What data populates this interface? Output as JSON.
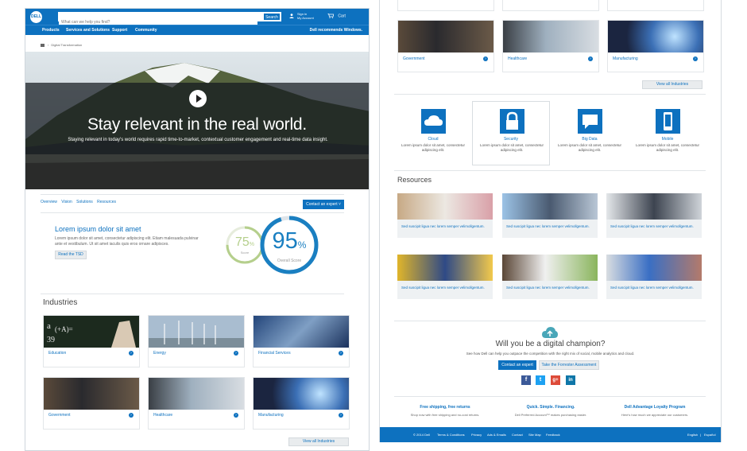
{
  "header": {
    "search_placeholder": "What can we help you find?",
    "search_button": "Search",
    "account_line1": "Sign in",
    "account_line2": "My Account",
    "cart_label": "Cart",
    "nav": [
      "Products",
      "Services and Solutions",
      "Support",
      "Community"
    ],
    "nav_right": "Dell recommends Windows."
  },
  "breadcrumb": "Digital Transformation",
  "hero": {
    "title": "Stay relevant in the real world.",
    "subtitle": "Staying relevant in today's world requires rapid time-to-market, contextual customer engagement and real-time data insight."
  },
  "tabs": [
    "Overview",
    "Vision",
    "Solutions",
    "Resources"
  ],
  "contact_button": "Contact an expert",
  "intro": {
    "title": "Lorem ipsum dolor sit amet",
    "body": "Lorem ipsum dolor sit amet, consectetur adipiscing elit. Etiam malesuada pulvinar ante et vestibulum. Ut sit amet iaculis quis eros ornare adipisces.",
    "button": "Read the TSD"
  },
  "scores": [
    {
      "value": "75",
      "unit": "%",
      "label": "Score",
      "fraction": 0.75,
      "color": "#b5cf8c"
    },
    {
      "value": "95",
      "unit": "%",
      "label": "Overall Score",
      "fraction": 0.95,
      "color": "#1a7fc1"
    }
  ],
  "industries": {
    "title": "Industries",
    "items": [
      "Education",
      "Energy",
      "Financial Services",
      "Government",
      "Healthcare",
      "Manufacturing"
    ],
    "view_all": "View all Industries"
  },
  "features": [
    {
      "title": "Cloud",
      "desc": "Lorem ipsum dolor sit amet, consectetur adipiscing elit."
    },
    {
      "title": "Security",
      "desc": "Lorem ipsum dolor sit amet, consectetur adipiscing elit."
    },
    {
      "title": "Big Data",
      "desc": "Lorem ipsum dolor sit amet, consectetur adipiscing elit."
    },
    {
      "title": "Mobile",
      "desc": "Lorem ipsum dolor sit amet, consectetur adipiscing elit."
    }
  ],
  "resources": {
    "title": "Resources",
    "caption": "Sed suscipit ligua nec lorem semper velimollgentum."
  },
  "champion": {
    "title": "Will you be a digital champion?",
    "subtitle": "See how Dell can help you outpace the competition with the right mix of social, mobile analytics and cloud.",
    "button_primary": "Contact an expert",
    "button_secondary": "Take the Forrester Assessment"
  },
  "social": [
    "f",
    "t",
    "g+",
    "in"
  ],
  "footer_promos": [
    {
      "title": "Free shipping, free returns",
      "desc": "Shop now with free shipping and no-cost returns."
    },
    {
      "title": "Quick. Simple. Financing.",
      "desc": "Dell Preferred Account™ makes purchasing easier."
    },
    {
      "title": "Dell Advantage Loyalty Program",
      "desc": "Here's how much we appreciate our customers."
    }
  ],
  "footer": {
    "copyright": "© 2014 Dell",
    "links": [
      "Terms & Conditions",
      "Privacy",
      "Ads & Emails",
      "Contact",
      "Site Map",
      "Feedback"
    ],
    "lang_en": "English",
    "lang_es": "Español"
  },
  "colors": {
    "brand": "#0d71bf",
    "link": "#0d71bf"
  }
}
